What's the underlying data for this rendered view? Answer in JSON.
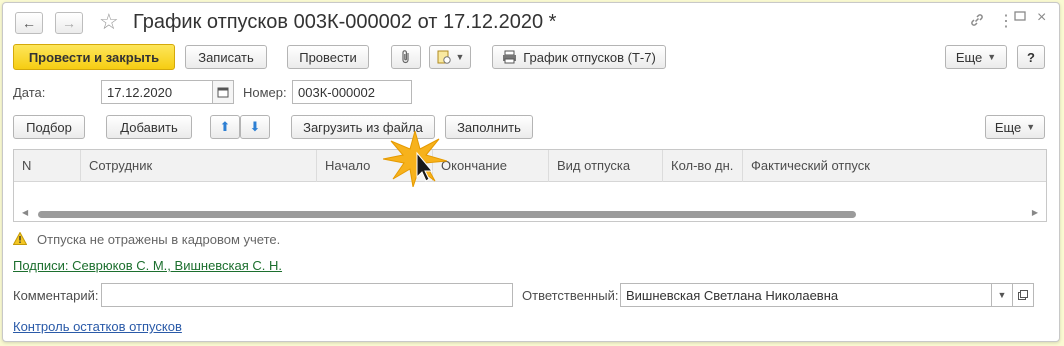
{
  "header": {
    "back_icon": "arrow-left-icon",
    "forward_icon": "arrow-right-icon",
    "favorite_icon": "star-icon",
    "title": "График отпусков 003К-000002 от 17.12.2020 *",
    "link_icon": "link-icon",
    "more_icon": "vertical-ellipsis-icon",
    "maximize_icon": "maximize-icon",
    "close_icon": "close-icon"
  },
  "toolbar": {
    "post_close": "Провести и закрыть",
    "save": "Записать",
    "post": "Провести",
    "attach_icon": "paperclip-icon",
    "report_icon": "report-icon",
    "print_icon": "printer-icon",
    "print_label": "График отпусков (Т-7)",
    "more": "Еще",
    "help": "?"
  },
  "form": {
    "date_label": "Дата:",
    "date_value": "17.12.2020",
    "calendar_icon": "calendar-icon",
    "number_label": "Номер:",
    "number_value": "003К-000002"
  },
  "table_toolbar": {
    "pick": "Подбор",
    "add": "Добавить",
    "up_icon": "arrow-up-icon",
    "down_icon": "arrow-down-icon",
    "load_file": "Загрузить из файла",
    "fill": "Заполнить",
    "more": "Еще"
  },
  "table": {
    "columns": [
      "N",
      "Сотрудник",
      "Начало",
      "Окончание",
      "Вид отпуска",
      "Кол-во дн.",
      "Фактический отпуск"
    ]
  },
  "warning": {
    "icon": "warning-icon",
    "text": "Отпуска не отражены в кадровом учете."
  },
  "signatures_link": "Подписи: Севрюков С. М., Вишневская С. Н.",
  "comment_label": "Комментарий:",
  "comment_value": "",
  "responsible_label": "Ответственный:",
  "responsible_value": "Вишневская Светлана Николаевна",
  "balance_link": "Контроль остатков отпусков",
  "colors": {
    "primary_button": "#f6cd12",
    "link_green": "#1c6f2e",
    "link_blue": "#2a5aa8",
    "background": "#fafad2"
  }
}
